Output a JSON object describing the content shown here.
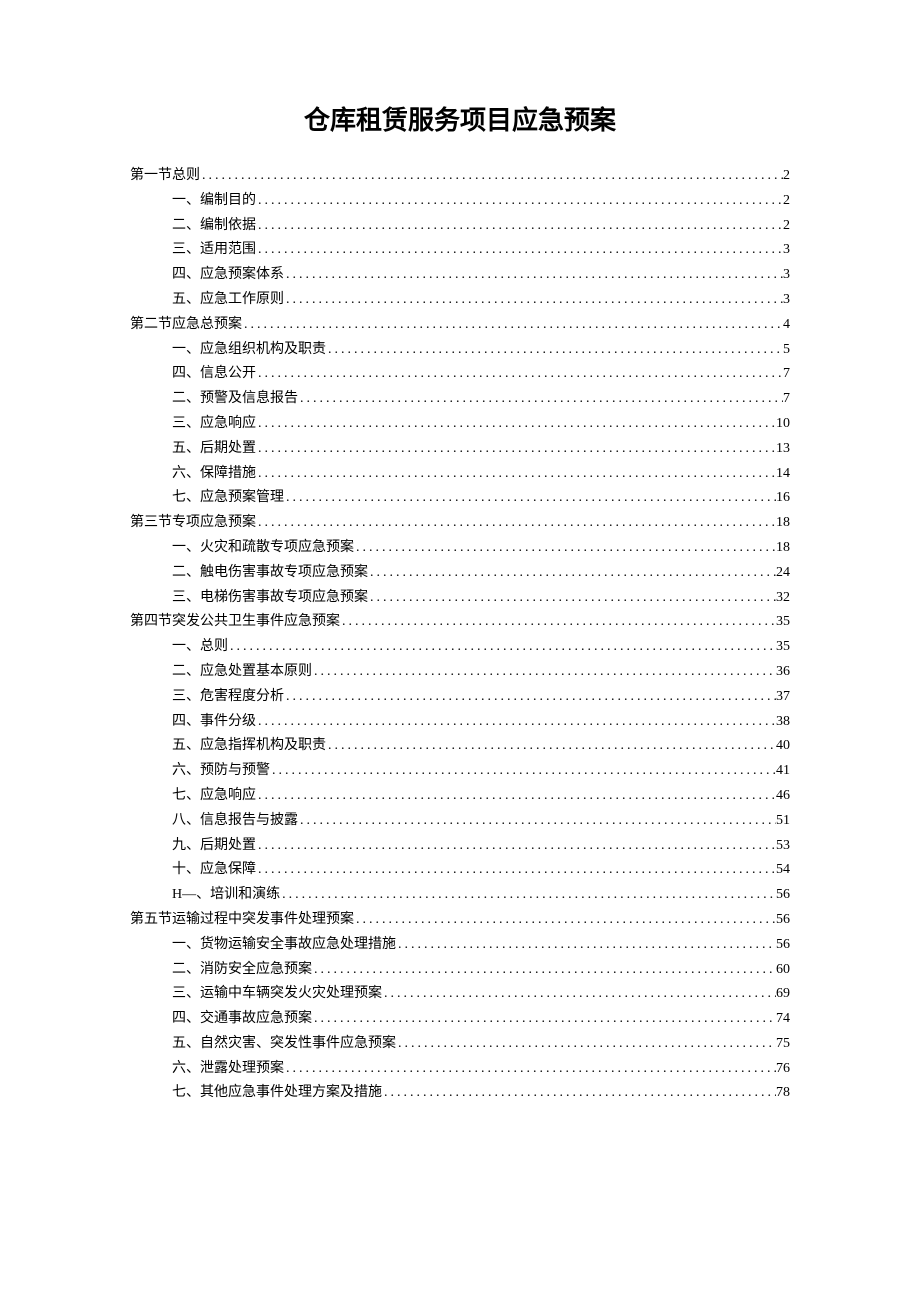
{
  "title": "仓库租赁服务项目应急预案",
  "toc": [
    {
      "level": 1,
      "label": "第一节总则",
      "page": "2"
    },
    {
      "level": 2,
      "label": "一、编制目的",
      "page": "2"
    },
    {
      "level": 2,
      "label": "二、编制依据",
      "page": "2"
    },
    {
      "level": 2,
      "label": "三、适用范围",
      "page": "3"
    },
    {
      "level": 2,
      "label": "四、应急预案体系",
      "page": "3"
    },
    {
      "level": 2,
      "label": "五、应急工作原则",
      "page": "3"
    },
    {
      "level": 1,
      "label": "第二节应急总预案",
      "page": "4"
    },
    {
      "level": 2,
      "label": "一、应急组织机构及职责",
      "page": "5"
    },
    {
      "level": 2,
      "label": "四、信息公开",
      "page": "7"
    },
    {
      "level": 2,
      "label": "二、预警及信息报告",
      "page": "7"
    },
    {
      "level": 2,
      "label": "三、应急响应",
      "page": "10"
    },
    {
      "level": 2,
      "label": "五、后期处置",
      "page": "13"
    },
    {
      "level": 2,
      "label": "六、保障措施",
      "page": "14"
    },
    {
      "level": 2,
      "label": "七、应急预案管理",
      "page": "16"
    },
    {
      "level": 1,
      "label": "第三节专项应急预案",
      "page": "18"
    },
    {
      "level": 2,
      "label": "一、火灾和疏散专项应急预案",
      "page": "18"
    },
    {
      "level": 2,
      "label": "二、触电伤害事故专项应急预案",
      "page": "24"
    },
    {
      "level": 2,
      "label": "三、电梯伤害事故专项应急预案",
      "page": "32"
    },
    {
      "level": 1,
      "label": "第四节突发公共卫生事件应急预案",
      "page": "35"
    },
    {
      "level": 2,
      "label": "一、总则",
      "page": "35"
    },
    {
      "level": 2,
      "label": "二、应急处置基本原则",
      "page": "36"
    },
    {
      "level": 2,
      "label": "三、危害程度分析",
      "page": "37"
    },
    {
      "level": 2,
      "label": "四、事件分级",
      "page": "38"
    },
    {
      "level": 2,
      "label": "五、应急指挥机构及职责",
      "page": "40"
    },
    {
      "level": 2,
      "label": "六、预防与预警",
      "page": "41"
    },
    {
      "level": 2,
      "label": "七、应急响应",
      "page": "46"
    },
    {
      "level": 2,
      "label": "八、信息报告与披露",
      "page": "51"
    },
    {
      "level": 2,
      "label": "九、后期处置",
      "page": "53"
    },
    {
      "level": 2,
      "label": "十、应急保障",
      "page": "54"
    },
    {
      "level": 2,
      "label": "H—、培训和演练",
      "page": "56"
    },
    {
      "level": 1,
      "label": "第五节运输过程中突发事件处理预案",
      "page": "56"
    },
    {
      "level": 2,
      "label": "一、货物运输安全事故应急处理措施",
      "page": "56"
    },
    {
      "level": 2,
      "label": "二、消防安全应急预案",
      "page": "60"
    },
    {
      "level": 2,
      "label": "三、运输中车辆突发火灾处理预案",
      "page": "69"
    },
    {
      "level": 2,
      "label": "四、交通事故应急预案",
      "page": "74"
    },
    {
      "level": 2,
      "label": "五、自然灾害、突发性事件应急预案",
      "page": "75"
    },
    {
      "level": 2,
      "label": "六、泄露处理预案",
      "page": "76"
    },
    {
      "level": 2,
      "label": "七、其他应急事件处理方案及措施",
      "page": "78"
    }
  ]
}
